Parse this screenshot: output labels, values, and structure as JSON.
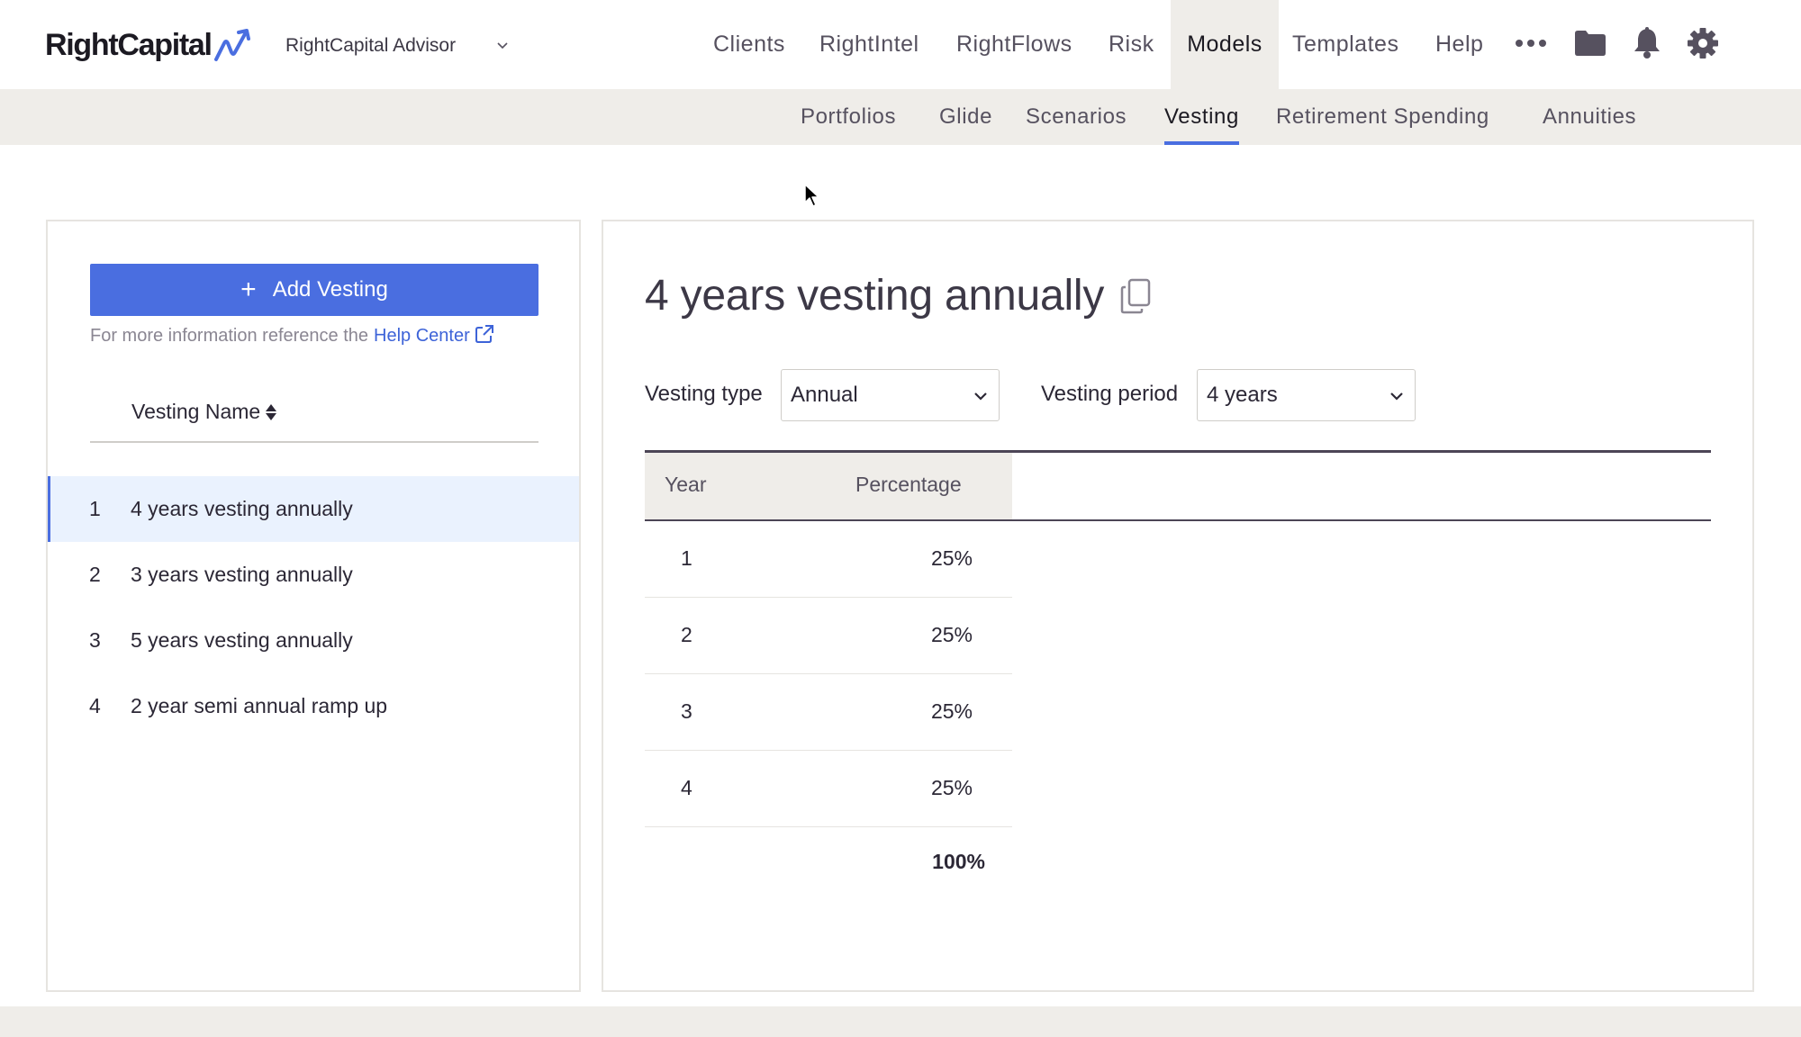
{
  "brand": {
    "name": "RightCapital"
  },
  "advisor": {
    "name": "RightCapital Advisor"
  },
  "nav": {
    "items": [
      "Clients",
      "RightIntel",
      "RightFlows",
      "Risk",
      "Models",
      "Templates",
      "Help"
    ],
    "active": "Models",
    "icons": [
      "more-icon",
      "folder-icon",
      "bell-icon",
      "gear-icon"
    ]
  },
  "subnav": {
    "items": [
      "Portfolios",
      "Glide",
      "Scenarios",
      "Vesting",
      "Retirement Spending",
      "Annuities"
    ],
    "active": "Vesting"
  },
  "sidebar": {
    "add_label": "Add Vesting",
    "help_prefix": "For more information reference the",
    "help_link": "Help Center",
    "column_header": "Vesting Name",
    "items": [
      {
        "num": "1",
        "name": "4 years vesting annually",
        "selected": true
      },
      {
        "num": "2",
        "name": "3 years vesting annually",
        "selected": false
      },
      {
        "num": "3",
        "name": "5 years vesting annually",
        "selected": false
      },
      {
        "num": "4",
        "name": "2 year semi annual ramp up",
        "selected": false
      }
    ]
  },
  "detail": {
    "title": "4 years vesting annually",
    "vesting_type_label": "Vesting type",
    "vesting_type_value": "Annual",
    "vesting_period_label": "Vesting period",
    "vesting_period_value": "4 years",
    "table": {
      "headers": [
        "Year",
        "Percentage"
      ],
      "rows": [
        {
          "year": "1",
          "pct": "25%"
        },
        {
          "year": "2",
          "pct": "25%"
        },
        {
          "year": "3",
          "pct": "25%"
        },
        {
          "year": "4",
          "pct": "25%"
        }
      ],
      "total": "100%"
    }
  },
  "colors": {
    "accent": "#4a6ee0",
    "link": "#3d63d8",
    "nav_bg": "#efede9",
    "selected_row": "#eaf2fe"
  }
}
